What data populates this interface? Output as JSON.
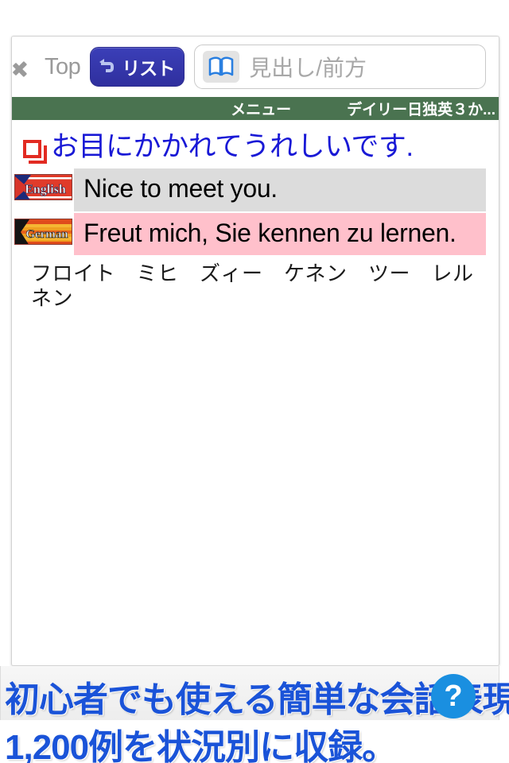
{
  "toolbar": {
    "back_label": "Top",
    "back_icon": "chevron-left-icon",
    "list_label": "リスト",
    "list_icon": "return-arrow-icon",
    "search_icon": "open-book-icon",
    "search_placeholder": "見出し/前方",
    "search_value": ""
  },
  "menu_bar": {
    "menu_label": "メニュー",
    "dictionary_title": "デイリー日独英３か...",
    "background_color": "#4a7350"
  },
  "entry": {
    "bullet_icon": "red-square-bullet-icon",
    "headword": "お目にかかれてうれしいです.",
    "headword_color": "#1919d6",
    "translations": [
      {
        "flag_icon": "english-flag-badge-icon",
        "language_label": "English",
        "sentence": "Nice to meet you.",
        "row_color": "#dcdcdc"
      },
      {
        "flag_icon": "german-flag-badge-icon",
        "language_label": "German",
        "sentence": "Freut mich, Sie kennen zu lernen.",
        "row_color": "#ffc0cb"
      }
    ],
    "pronunciation": "フロイト　ミヒ　ズィー　ケネン　ツー　レルネン"
  },
  "ad_banner": {
    "line_1": "初心者でも使える簡単な会話表現",
    "line_2": "1,200例を状況別に収録。",
    "help_badge": "?",
    "text_color": "#1a53d8",
    "badge_color": "#1a8fe0"
  }
}
